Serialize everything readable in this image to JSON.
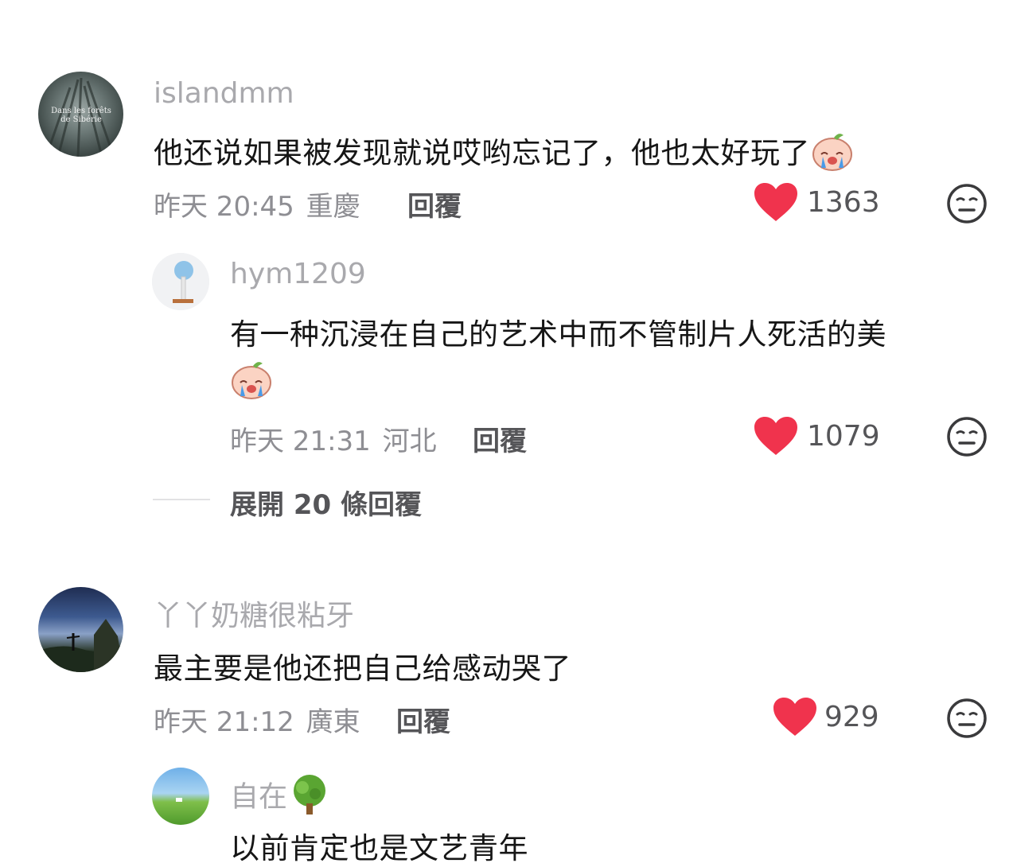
{
  "comments": [
    {
      "username": "islandmm",
      "text": "他还说如果被发现就说哎哟忘记了，他也太好玩了",
      "emoji": "crying-peach-sticker",
      "time": "昨天 20:45",
      "location": "重慶",
      "reply_label": "回覆",
      "likes": "1363",
      "avatar_text": "Dans les forêts de Sibérie",
      "replies": [
        {
          "username": "hym1209",
          "text_line1": "有一种沉浸在自己的艺术中而不管制片人死活的美",
          "emoji": "crying-peach-sticker",
          "time": "昨天 21:31",
          "location": "河北",
          "reply_label": "回覆",
          "likes": "1079"
        }
      ],
      "expand_label": "展開 20 條回覆"
    },
    {
      "username": "丫丫奶糖很粘牙",
      "text": "最主要是他还把自己给感动哭了",
      "time": "昨天 21:12",
      "location": "廣東",
      "reply_label": "回覆",
      "likes": "929",
      "replies": [
        {
          "username": "自在",
          "username_emoji": "tree-icon",
          "text": "以前肯定也是文艺青年"
        }
      ]
    }
  ],
  "colors": {
    "heart": "#f0334d",
    "username": "#a9a9ad",
    "meta": "#8e8e93",
    "text": "#161616"
  }
}
